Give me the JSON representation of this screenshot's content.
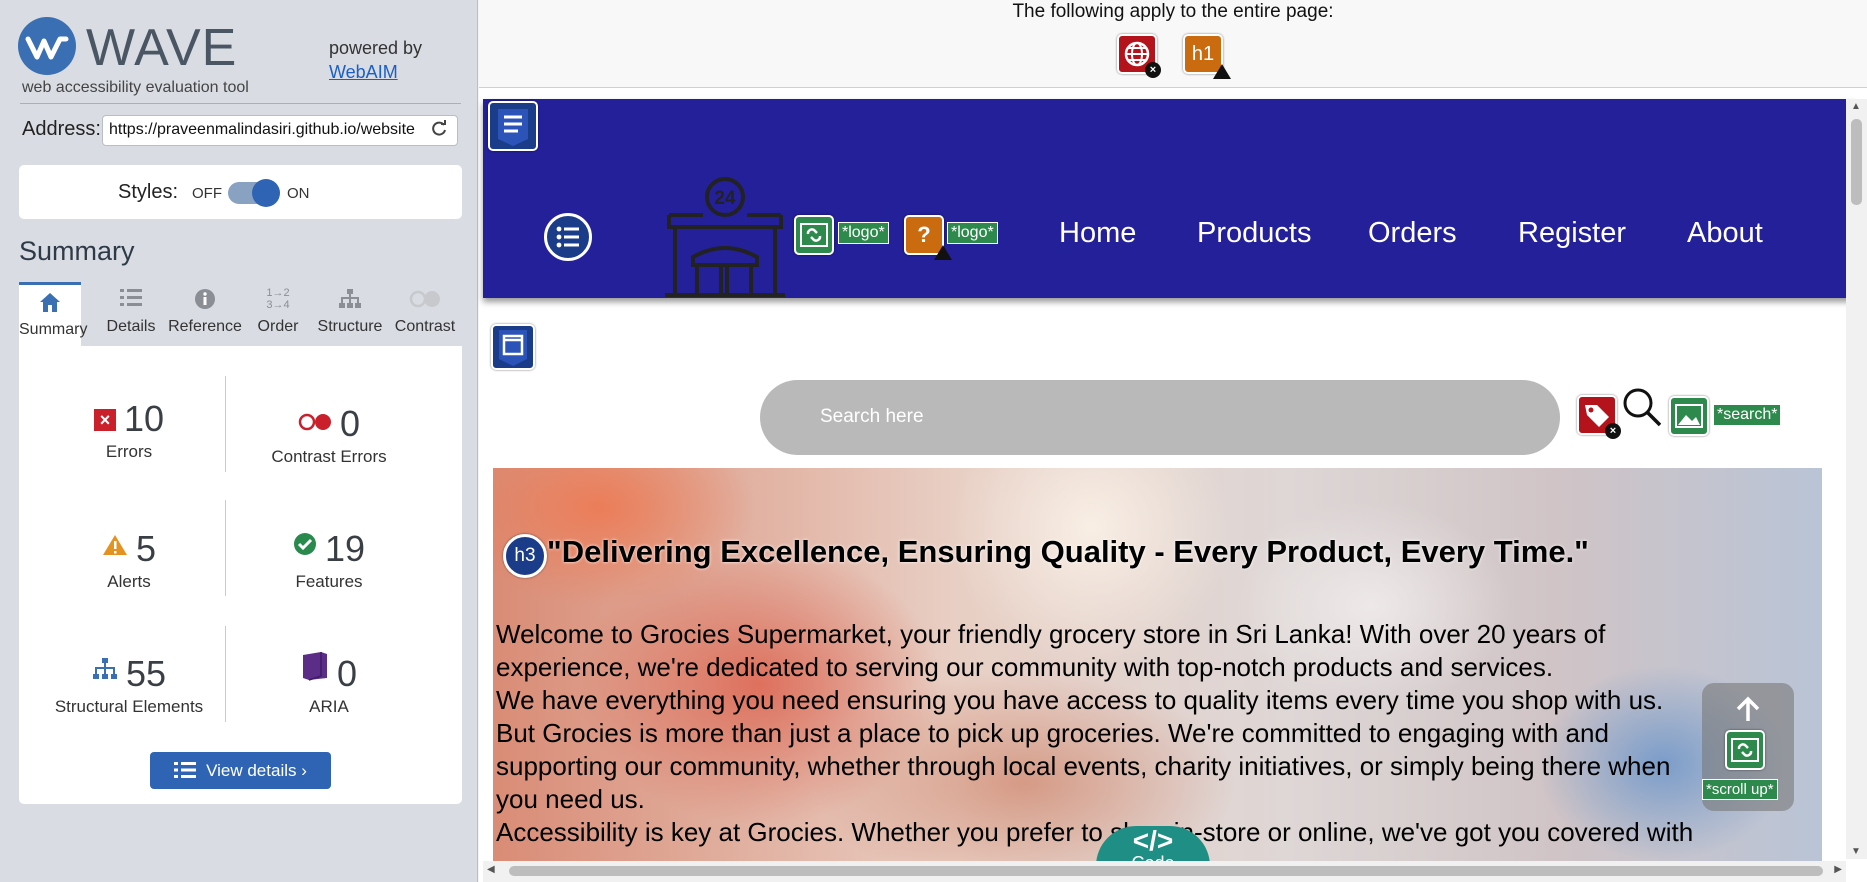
{
  "wave": {
    "logo_text": "WAVE",
    "tagline": "web accessibility evaluation tool",
    "powered_by": "powered by",
    "webaim_link": "WebAIM",
    "address_label": "Address:",
    "address_value": "https://praveenmalindasiri.github.io/website",
    "styles_label": "Styles:",
    "styles_off": "OFF",
    "styles_on": "ON",
    "styles_state": "on",
    "summary_title": "Summary",
    "tabs": [
      {
        "label": "Summary",
        "icon": "home-icon",
        "active": true
      },
      {
        "label": "Details",
        "icon": "list-icon",
        "active": false
      },
      {
        "label": "Reference",
        "icon": "info-icon",
        "active": false
      },
      {
        "label": "Order",
        "icon": "order-icon",
        "active": false
      },
      {
        "label": "Structure",
        "icon": "structure-icon",
        "active": false
      },
      {
        "label": "Contrast",
        "icon": "contrast-icon",
        "active": false
      }
    ],
    "stats": {
      "errors": {
        "count": "10",
        "label": "Errors"
      },
      "contrast": {
        "count": "0",
        "label": "Contrast Errors"
      },
      "alerts": {
        "count": "5",
        "label": "Alerts"
      },
      "features": {
        "count": "19",
        "label": "Features"
      },
      "structural": {
        "count": "55",
        "label": "Structural Elements"
      },
      "aria": {
        "count": "0",
        "label": "ARIA"
      }
    },
    "view_details": "View details ›"
  },
  "page": {
    "apply_text": "The following apply to the entire page:",
    "page_icons": [
      {
        "name": "language-error-icon",
        "color": "#b5131c"
      },
      {
        "name": "h1-alert-icon",
        "text": "h1",
        "color": "#cb6b10"
      }
    ],
    "nav": {
      "logo_labels": [
        "*logo*",
        "*logo*"
      ],
      "links": [
        "Home",
        "Products",
        "Orders",
        "Register",
        "About"
      ],
      "store_badge": "24"
    },
    "search": {
      "placeholder": "Search here",
      "label": "*search*"
    },
    "hero": {
      "heading_tag": "h3",
      "title": "\"Delivering Excellence, Ensuring Quality - Every Product, Every Time.\"",
      "paragraphs": [
        "Welcome to Grocies Supermarket, your friendly grocery store in Sri Lanka! With over 20 years of",
        "experience, we're dedicated to serving our community with top-notch products and services.",
        "We have everything you need ensuring you have access to quality items every time you shop with us.",
        "But Grocies is more than just a place to pick up groceries. We're committed to engaging with and",
        "supporting our community, whether through local events, charity initiatives, or simply being there when",
        "you need us.",
        "Accessibility is key at Grocies. Whether you prefer to shop in-store or online, we've got you covered with"
      ]
    },
    "scroll_up_label": "*scroll up*",
    "code_button": "Code",
    "colors": {
      "navbar": "#23209a",
      "wave_blue": "#2f64b5",
      "error_red": "#c9202b",
      "feature_green": "#2d8a4c"
    }
  }
}
